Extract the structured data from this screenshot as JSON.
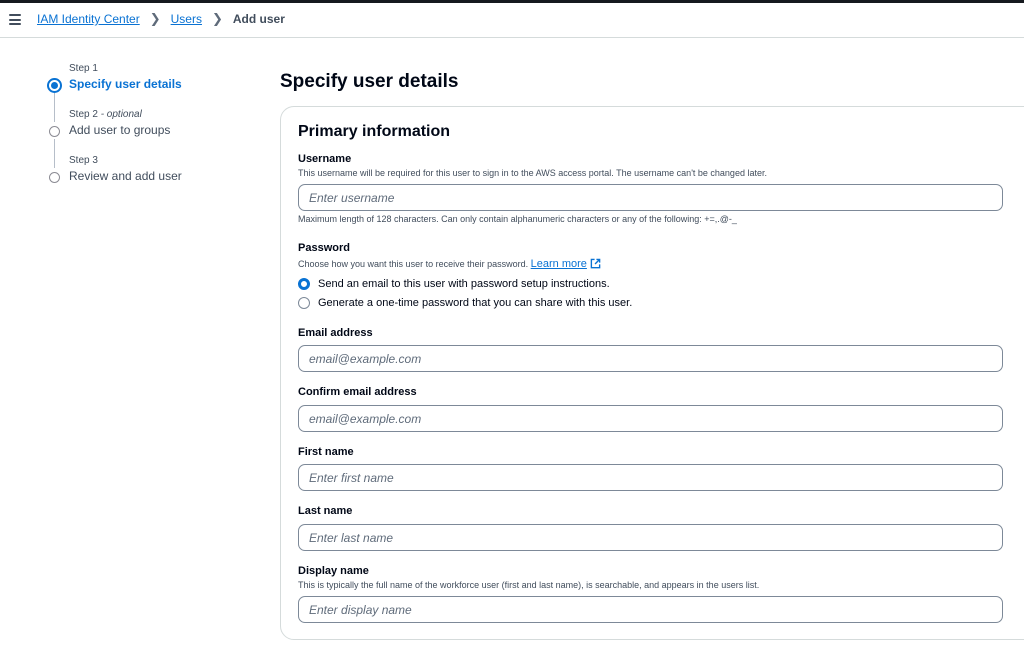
{
  "breadcrumbs": {
    "root": "IAM Identity Center",
    "users": "Users",
    "current": "Add user"
  },
  "steps": [
    {
      "label": "Step 1",
      "optional": "",
      "name": "Specify user details",
      "active": true
    },
    {
      "label": "Step 2",
      "optional": " - optional",
      "name": "Add user to groups",
      "active": false
    },
    {
      "label": "Step 3",
      "optional": "",
      "name": "Review and add user",
      "active": false
    }
  ],
  "page_title": "Specify user details",
  "panel": {
    "title": "Primary information",
    "username": {
      "label": "Username",
      "description": "This username will be required for this user to sign in to the AWS access portal. The username can't be changed later.",
      "placeholder": "Enter username",
      "value": "",
      "constraint": "Maximum length of 128 characters. Can only contain alphanumeric characters or any of the following: +=,.@-_"
    },
    "password": {
      "label": "Password",
      "description": "Choose how you want this user to receive their password.",
      "learn_more": "Learn more",
      "options": [
        {
          "label": "Send an email to this user with password setup instructions.",
          "checked": true
        },
        {
          "label": "Generate a one-time password that you can share with this user.",
          "checked": false
        }
      ]
    },
    "email": {
      "label": "Email address",
      "placeholder": "email@example.com",
      "value": ""
    },
    "confirm_email": {
      "label": "Confirm email address",
      "placeholder": "email@example.com",
      "value": ""
    },
    "first_name": {
      "label": "First name",
      "placeholder": "Enter first name",
      "value": ""
    },
    "last_name": {
      "label": "Last name",
      "placeholder": "Enter last name",
      "value": ""
    },
    "display_name": {
      "label": "Display name",
      "description": "This is typically the full name of the workforce user (first and last name), is searchable, and appears in the users list.",
      "placeholder": "Enter display name",
      "value": ""
    }
  },
  "colors": {
    "accent": "#0972d3",
    "text": "#000716",
    "border": "#7d8998"
  },
  "icons": [
    "menu-icon",
    "chevron-right-icon",
    "external-link-icon"
  ]
}
